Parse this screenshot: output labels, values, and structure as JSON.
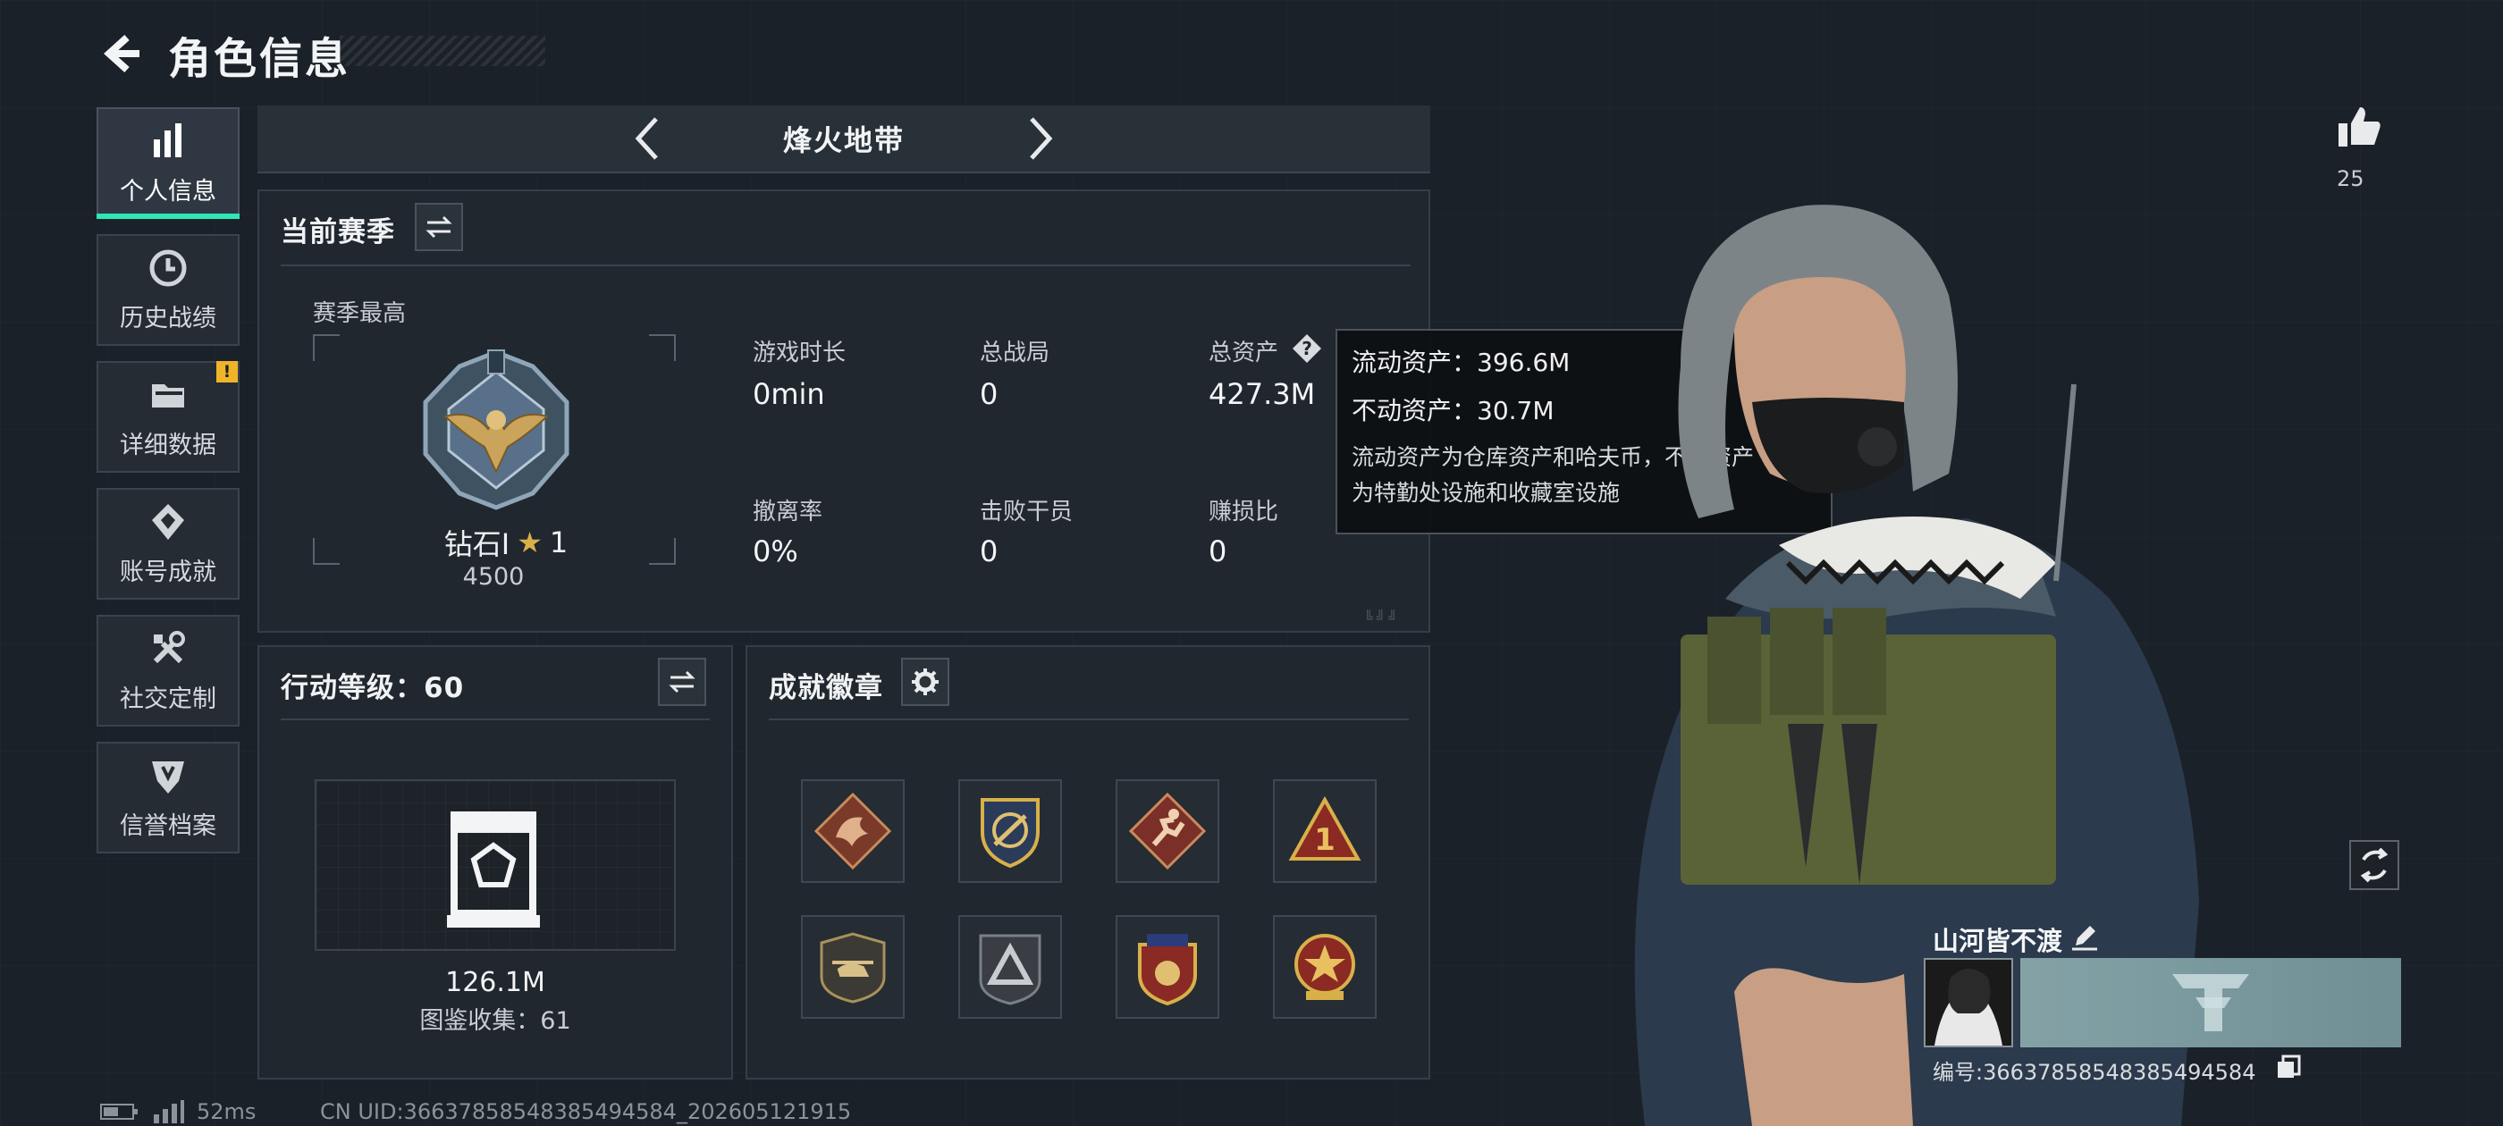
{
  "header": {
    "title": "角色信息"
  },
  "sidebar": {
    "items": [
      {
        "label": "个人信息",
        "icon": "bar-chart-icon",
        "active": true
      },
      {
        "label": "历史战绩",
        "icon": "history-icon"
      },
      {
        "label": "详细数据",
        "icon": "folder-icon",
        "badge": "!"
      },
      {
        "label": "账号成就",
        "icon": "achievement-icon"
      },
      {
        "label": "社交定制",
        "icon": "tools-icon"
      },
      {
        "label": "信誉档案",
        "icon": "credit-icon"
      }
    ]
  },
  "mode": {
    "name": "烽火地带"
  },
  "season": {
    "title": "当前赛季",
    "best_label": "赛季最高",
    "rank": "钻石Ⅰ",
    "stars": "1",
    "score": "4500",
    "stats": [
      {
        "label": "游戏时长",
        "value": "0min"
      },
      {
        "label": "总战局",
        "value": "0"
      },
      {
        "label": "总资产",
        "value": "427.3M"
      },
      {
        "label": "撤离率",
        "value": "0%"
      },
      {
        "label": "击败干员",
        "value": "0"
      },
      {
        "label": "赚损比",
        "value": "0"
      }
    ]
  },
  "tooltip": {
    "liquid": "流动资产：396.6M",
    "fixed": "不动资产：30.7M",
    "desc_line1": "流动资产为仓库资产和哈夫币，不动资产",
    "desc_line2": "为特勤处设施和收藏室设施"
  },
  "action_level": {
    "title": "行动等级：60",
    "value": "126.1M",
    "collection": "图鉴收集：61"
  },
  "achievements": {
    "title": "成就徽章",
    "badges": [
      "dragon-badge-icon",
      "crest-badge-icon",
      "runner-badge-icon",
      "number-one-badge-icon",
      "helicopter-badge-icon",
      "triangle-badge-icon",
      "shield-star-badge-icon",
      "wreath-badge-icon"
    ]
  },
  "profile": {
    "likes": "25",
    "name": "山河皆不渡",
    "id": "编号:36637858548385494584"
  },
  "footer": {
    "ping": "52ms",
    "uid": "CN UID:36637858548385494584_202605121915"
  }
}
